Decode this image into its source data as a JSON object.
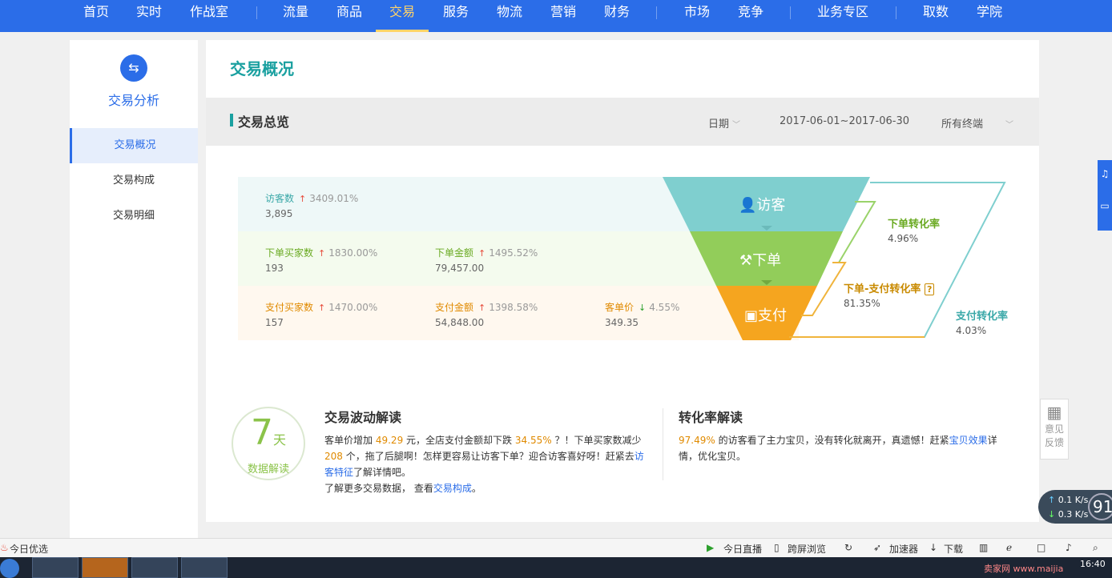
{
  "topnav": {
    "items": [
      "首页",
      "实时",
      "作战室",
      "流量",
      "商品",
      "交易",
      "服务",
      "物流",
      "营销",
      "财务",
      "市场",
      "竞争",
      "业务专区",
      "取数",
      "学院"
    ],
    "active_index": 5
  },
  "sidebar": {
    "icon": "exchange-icon",
    "title": "交易分析",
    "items": [
      "交易概况",
      "交易构成",
      "交易明细"
    ],
    "active_index": 0
  },
  "main": {
    "page_title": "交易概况",
    "section_title": "交易总览",
    "filters": {
      "date_label": "日期",
      "date_range": "2017-06-01~2017-06-30",
      "terminal": "所有终端"
    }
  },
  "funnel": {
    "visitors": {
      "label": "访客数",
      "change": "3409.01%",
      "value": "3,895"
    },
    "order_buyers": {
      "label": "下单买家数",
      "change": "1830.00%",
      "value": "193"
    },
    "order_amount": {
      "label": "下单金额",
      "change": "1495.52%",
      "value": "79,457.00"
    },
    "pay_buyers": {
      "label": "支付买家数",
      "change": "1470.00%",
      "value": "157"
    },
    "pay_amount": {
      "label": "支付金额",
      "change": "1398.58%",
      "value": "54,848.00"
    },
    "unit_price": {
      "label": "客单价",
      "change": "4.55%",
      "value": "349.35"
    },
    "stages": {
      "visit": "访客",
      "order": "下单",
      "pay": "支付"
    },
    "colors": {
      "visit": "#7fcfcf",
      "order": "#92cd5a",
      "pay": "#f5a51f",
      "arrow_green": "#9ad36a",
      "arrow_orange": "#f0b43c",
      "outline_teal": "#7fcfcf"
    }
  },
  "rates": {
    "order_rate": {
      "label": "下单转化率",
      "value": "4.96%"
    },
    "order_pay_rate": {
      "label": "下单-支付转化率",
      "value": "81.35%"
    },
    "pay_rate": {
      "label": "支付转化率",
      "value": "4.03%"
    }
  },
  "badge": {
    "big": "7",
    "unit": "天",
    "sub": "数据解读"
  },
  "interp_left": {
    "title": "交易波动解读",
    "p1_a": "客单价增加",
    "p1_v1": "49.29",
    "p1_b": "元，全店支付金额却下跌",
    "p1_v2": "34.55%",
    "p1_c": "？！下单买家数减少",
    "p1_v3": "208",
    "p1_d": "个，拖了后腿啊！怎样更容易让访客下单？迎合访客喜好呀！赶紧去",
    "p1_link": "访客特征",
    "p1_e": "了解详情吧。",
    "p2_a": "了解更多交易数据，  查看",
    "p2_link": "交易构成",
    "p2_b": "。"
  },
  "interp_right": {
    "title": "转化率解读",
    "pct": "97.49%",
    "text_a": "的访客看了主力宝贝，没有转化就离开，真遗憾！赶紧",
    "link": "宝贝效果",
    "text_b": "详情，优化宝贝。"
  },
  "side_widgets": {
    "qr_label_1": "意见",
    "qr_label_2": "反馈",
    "up_speed": "0.1",
    "down_speed": "0.3",
    "speed_unit": "K/s",
    "gauge": "91"
  },
  "statusbar": {
    "left": "今日优选",
    "items": [
      "今日直播",
      "跨屏浏览",
      "加速器",
      "下载"
    ]
  },
  "taskbar": {
    "watermark": "卖家网 www.maijia",
    "clock": "16:40"
  }
}
